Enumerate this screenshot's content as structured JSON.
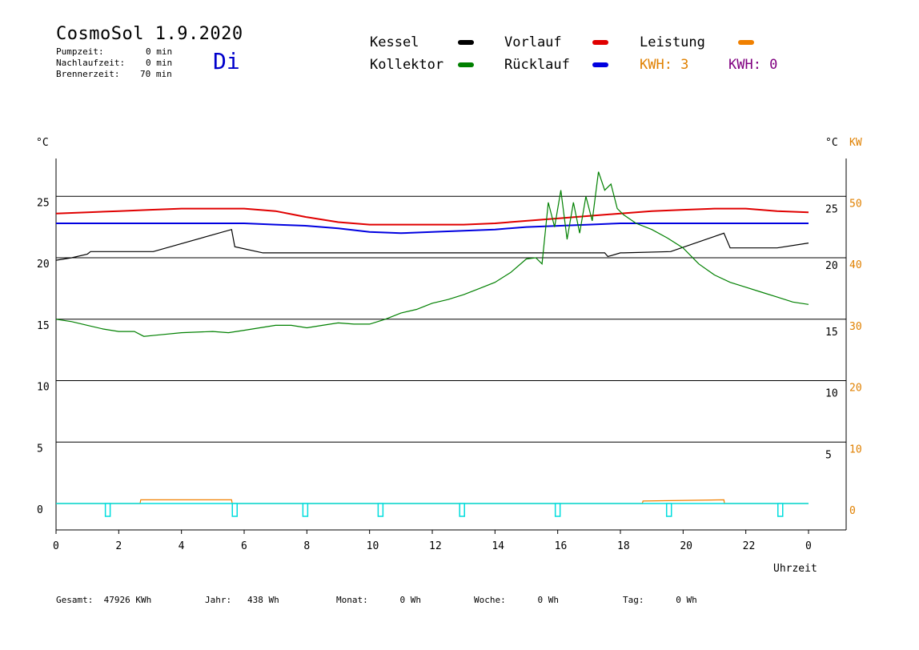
{
  "header": {
    "title": "CosmoSol 1.9.2020",
    "day": "Di",
    "stats": [
      {
        "label": "Pumpzeit:",
        "value": "0 min"
      },
      {
        "label": "Nachlaufzeit:",
        "value": "0 min"
      },
      {
        "label": "Brennerzeit:",
        "value": "70 min"
      }
    ]
  },
  "legend": {
    "items": [
      {
        "label": "Kessel",
        "color": "#000000"
      },
      {
        "label": "Vorlauf",
        "color": "#e00000"
      },
      {
        "label": "Leistung",
        "color": "#f08000"
      },
      {
        "label": "Kollektor",
        "color": "#008000"
      },
      {
        "label": "Rücklauf",
        "color": "#0000e0"
      }
    ],
    "kwh_orange": {
      "label": "KWH: 3",
      "color": "#e08000"
    },
    "kwh_purple": {
      "label": "KWH: 0",
      "color": "#800080"
    }
  },
  "footer": {
    "gesamt": "Gesamt:  47926 KWh",
    "jahr": "Jahr:   438 Wh",
    "monat": "Monat:      0 Wh",
    "woche": "Woche:      0 Wh",
    "tag": "Tag:      0 Wh"
  },
  "chart_data": {
    "type": "line",
    "xlabel": "Uhrzeit",
    "ylabel_left": "°C",
    "ylabel_right": "°C",
    "ylabel_right_power": "KW",
    "x_ticks": [
      "0",
      "2",
      "4",
      "6",
      "8",
      "10",
      "12",
      "14",
      "16",
      "18",
      "20",
      "22",
      "0"
    ],
    "xlim": [
      0,
      24
    ],
    "ylim": [
      -2,
      28
    ],
    "y_ticks_left": [
      0,
      5,
      10,
      15,
      20,
      25
    ],
    "y_ticks_right_temp": [
      5,
      10,
      15,
      20,
      25
    ],
    "y_ticks_right_power": [
      0,
      10,
      20,
      30,
      40,
      50
    ],
    "gridlines": [
      5,
      10,
      15,
      20,
      25
    ],
    "series": [
      {
        "name": "Vorlauf",
        "color": "#e00000",
        "x": [
          0,
          1,
          2,
          3,
          4,
          5,
          6,
          7,
          8,
          9,
          10,
          11,
          12,
          13,
          14,
          15,
          16,
          17,
          18,
          19,
          20,
          21,
          22,
          23,
          24
        ],
        "y": [
          23.6,
          23.7,
          23.8,
          23.9,
          24.0,
          24.0,
          24.0,
          23.8,
          23.3,
          22.9,
          22.7,
          22.7,
          22.7,
          22.7,
          22.8,
          23.0,
          23.2,
          23.4,
          23.6,
          23.8,
          23.9,
          24.0,
          24.0,
          23.8,
          23.7
        ]
      },
      {
        "name": "Rücklauf",
        "color": "#0000e0",
        "x": [
          0,
          2,
          4,
          6,
          7,
          8,
          9,
          10,
          11,
          12,
          13,
          14,
          15,
          16,
          17,
          18,
          19,
          20,
          21,
          22,
          23,
          24
        ],
        "y": [
          22.8,
          22.8,
          22.8,
          22.8,
          22.7,
          22.6,
          22.4,
          22.1,
          22.0,
          22.1,
          22.2,
          22.3,
          22.5,
          22.6,
          22.7,
          22.8,
          22.8,
          22.8,
          22.8,
          22.8,
          22.8,
          22.8
        ]
      },
      {
        "name": "Kessel",
        "color": "#000000",
        "x": [
          0,
          0.5,
          1.0,
          1.1,
          3.1,
          5.6,
          5.7,
          6.6,
          8.1,
          17.5,
          17.6,
          18.0,
          18.1,
          19.6,
          21.3,
          21.5,
          23.0,
          24.0
        ],
        "y": [
          19.8,
          20.0,
          20.3,
          20.5,
          20.5,
          22.3,
          20.9,
          20.4,
          20.4,
          20.4,
          20.1,
          20.4,
          20.4,
          20.5,
          22.0,
          20.8,
          20.8,
          21.2
        ]
      },
      {
        "name": "Kollektor",
        "color": "#008000",
        "x": [
          0,
          0.5,
          1,
          1.5,
          2,
          2.5,
          2.8,
          3.2,
          4,
          5,
          5.5,
          6,
          6.5,
          7,
          7.5,
          8,
          8.5,
          9,
          9.5,
          10,
          10.5,
          11,
          11.5,
          12,
          12.5,
          13,
          13.5,
          14,
          14.5,
          15,
          15.3,
          15.5,
          15.7,
          15.9,
          16.1,
          16.3,
          16.5,
          16.7,
          16.9,
          17.1,
          17.3,
          17.5,
          17.7,
          17.9,
          18.1,
          18.5,
          19,
          19.5,
          20,
          20.5,
          21,
          21.5,
          22,
          22.5,
          23,
          23.5,
          24
        ],
        "y": [
          15.0,
          14.8,
          14.5,
          14.2,
          14.0,
          14.0,
          13.6,
          13.7,
          13.9,
          14.0,
          13.9,
          14.1,
          14.3,
          14.5,
          14.5,
          14.3,
          14.5,
          14.7,
          14.6,
          14.6,
          15.0,
          15.5,
          15.8,
          16.3,
          16.6,
          17.0,
          17.5,
          18.0,
          18.8,
          19.9,
          20.0,
          19.5,
          24.5,
          22.5,
          25.5,
          21.5,
          24.5,
          22.0,
          25.0,
          23.0,
          27.0,
          25.5,
          26.0,
          24.0,
          23.5,
          22.8,
          22.3,
          21.6,
          20.8,
          19.5,
          18.6,
          18.0,
          17.6,
          17.2,
          16.8,
          16.4,
          16.2
        ]
      },
      {
        "name": "Leistung",
        "color": "#f08000",
        "x": [
          0,
          2.68,
          2.7,
          5.6,
          5.62,
          18.7,
          18.72,
          21.3,
          21.32,
          24
        ],
        "y": [
          0,
          0,
          0.3,
          0.3,
          0,
          0,
          0.2,
          0.3,
          0,
          0
        ]
      }
    ],
    "pump_pulses_hours": [
      1.65,
      5.7,
      7.95,
      10.35,
      12.95,
      16.0,
      19.55,
      23.1
    ],
    "pump_color": "#00dddd"
  }
}
